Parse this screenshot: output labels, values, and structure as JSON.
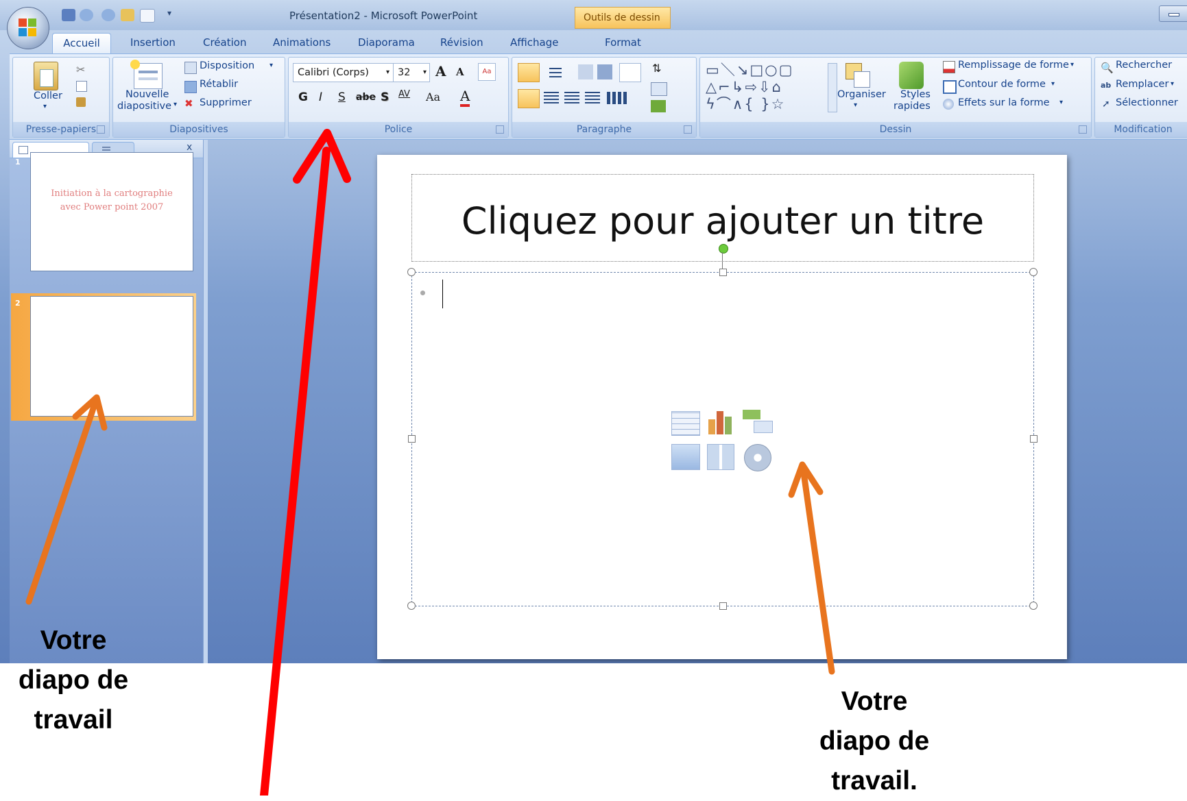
{
  "window": {
    "title": "Présentation2 - Microsoft PowerPoint",
    "contextual_tab_group": "Outils de dessin"
  },
  "tabs": [
    "Accueil",
    "Insertion",
    "Création",
    "Animations",
    "Diaporama",
    "Révision",
    "Affichage",
    "Format"
  ],
  "ribbon": {
    "clipboard": {
      "paste": "Coller",
      "group": "Presse-papiers"
    },
    "slides": {
      "new_slide_1": "Nouvelle",
      "new_slide_2": "diapositive",
      "layout": "Disposition",
      "reset": "Rétablir",
      "delete": "Supprimer",
      "group": "Diapositives"
    },
    "font": {
      "font_name": "Calibri (Corps)",
      "font_size": "32",
      "bold": "G",
      "italic": "I",
      "underline": "S",
      "strike": "abe",
      "shadow": "S",
      "spacing": "AV",
      "case": "Aa",
      "color": "A",
      "grow": "A",
      "shrink": "A",
      "group": "Police"
    },
    "paragraph": {
      "group": "Paragraphe"
    },
    "drawing": {
      "arrange": "Organiser",
      "quick_styles_1": "Styles",
      "quick_styles_2": "rapides",
      "fill": "Remplissage de forme",
      "outline": "Contour de forme",
      "effects": "Effets sur la forme",
      "group": "Dessin"
    },
    "editing": {
      "find": "Rechercher",
      "replace": "Remplacer",
      "select": "Sélectionner",
      "group": "Modification"
    }
  },
  "slides_pane": {
    "close": "x",
    "slides": [
      {
        "number": "1",
        "title_line1": "Initiation à la cartographie",
        "title_line2": "avec Power point 2007"
      },
      {
        "number": "2"
      }
    ]
  },
  "slide": {
    "title_placeholder": "Cliquez pour ajouter un titre"
  },
  "annotations": {
    "left_1": "Votre",
    "left_2": "diapo de",
    "left_3": "travail",
    "right_1": "Votre",
    "right_2": "diapo de",
    "right_3": "travail."
  },
  "colors": {
    "ribbon_text": "#15428b",
    "red_arrow": "#ff0000",
    "orange_arrow": "#e8741e",
    "selected_thumb": "#f5a742",
    "slide_title_thumb": "#e07d7d"
  },
  "icons": [
    "office-button",
    "save-icon",
    "undo-icon",
    "redo-icon",
    "open-icon",
    "new-icon",
    "paste-icon",
    "cut-icon",
    "copy-icon",
    "format-painter-icon",
    "new-slide-icon",
    "layout-icon",
    "reset-icon",
    "delete-icon",
    "grow-font-icon",
    "shrink-font-icon",
    "clear-format-icon",
    "bullets-icon",
    "numbering-icon",
    "indent-icon",
    "line-spacing-icon",
    "align-left-icon",
    "align-center-icon",
    "align-right-icon",
    "justify-icon",
    "columns-icon",
    "shapes-gallery-icon",
    "arrange-icon",
    "quick-styles-icon",
    "fill-icon",
    "outline-icon",
    "effects-icon",
    "find-icon",
    "replace-icon",
    "select-icon",
    "insert-table-icon",
    "insert-chart-icon",
    "insert-smartart-icon",
    "insert-picture-icon",
    "insert-clipart-icon",
    "insert-media-icon"
  ]
}
